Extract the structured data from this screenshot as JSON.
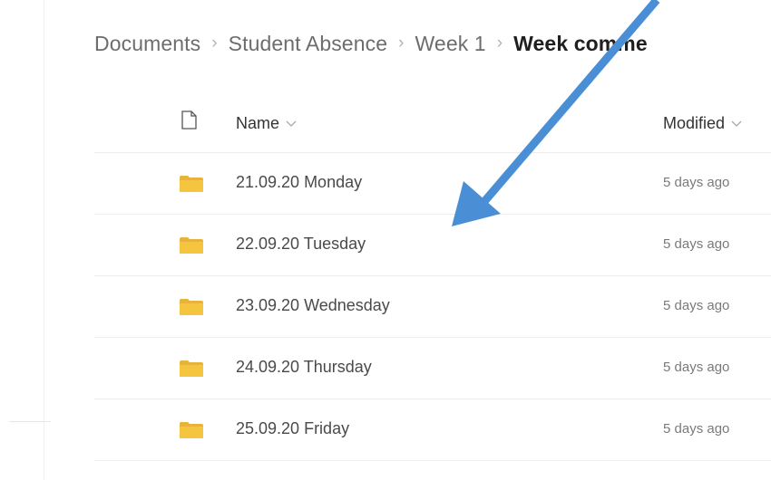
{
  "breadcrumb": {
    "items": [
      "Documents",
      "Student Absence",
      "Week 1"
    ],
    "current": "Week comme",
    "separator": "›"
  },
  "list": {
    "columns": {
      "name": "Name",
      "modified": "Modified"
    },
    "rows": [
      {
        "name": "21.09.20 Monday",
        "modified": "5 days ago"
      },
      {
        "name": "22.09.20 Tuesday",
        "modified": "5 days ago"
      },
      {
        "name": "23.09.20 Wednesday",
        "modified": "5 days ago"
      },
      {
        "name": "24.09.20 Thursday",
        "modified": "5 days ago"
      },
      {
        "name": "25.09.20 Friday",
        "modified": "5 days ago"
      }
    ]
  },
  "icons": {
    "folder": "folder-icon",
    "file_type": "document-icon",
    "sort": "chevron-down-icon"
  },
  "colors": {
    "folder": "#f5c53f",
    "folder_back": "#e8b33a",
    "annotation_arrow": "#4a8fd6"
  }
}
